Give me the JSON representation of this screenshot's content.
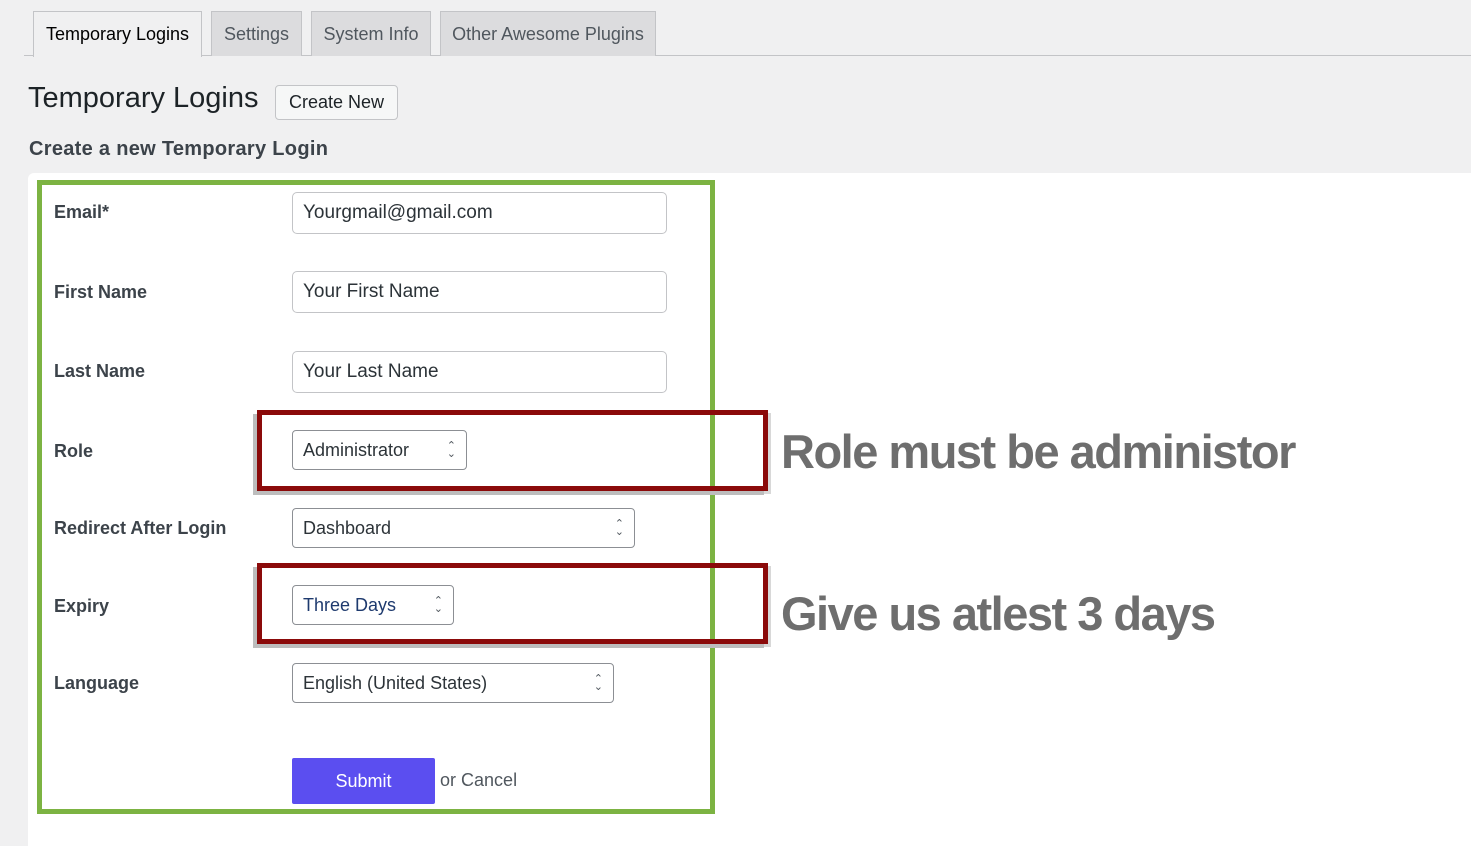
{
  "tabs": [
    {
      "label": "Temporary Logins",
      "active": true
    },
    {
      "label": "Settings",
      "active": false
    },
    {
      "label": "System Info",
      "active": false
    },
    {
      "label": "Other Awesome Plugins",
      "active": false
    }
  ],
  "header": {
    "title": "Temporary Logins",
    "create_new_label": "Create New"
  },
  "form": {
    "subtitle": "Create a new Temporary Login",
    "email": {
      "label": "Email*",
      "value": "Yourgmail@gmail.com"
    },
    "first_name": {
      "label": "First Name",
      "value": "Your First Name"
    },
    "last_name": {
      "label": "Last Name",
      "value": "Your Last Name"
    },
    "role": {
      "label": "Role",
      "value": "Administrator"
    },
    "redirect": {
      "label": "Redirect After Login",
      "value": "Dashboard"
    },
    "expiry": {
      "label": "Expiry",
      "value": "Three Days"
    },
    "language": {
      "label": "Language",
      "value": "English (United States)"
    },
    "submit_label": "Submit",
    "or_text": "or",
    "cancel_label": "Cancel"
  },
  "annotations": {
    "role_note": "Role must be administor",
    "expiry_note": "Give us atlest 3 days"
  },
  "colors": {
    "green_frame": "#7cb342",
    "red_box": "#8b0a0a",
    "submit_button": "#5b4ef0",
    "annotation_text": "#6e6e6e"
  }
}
